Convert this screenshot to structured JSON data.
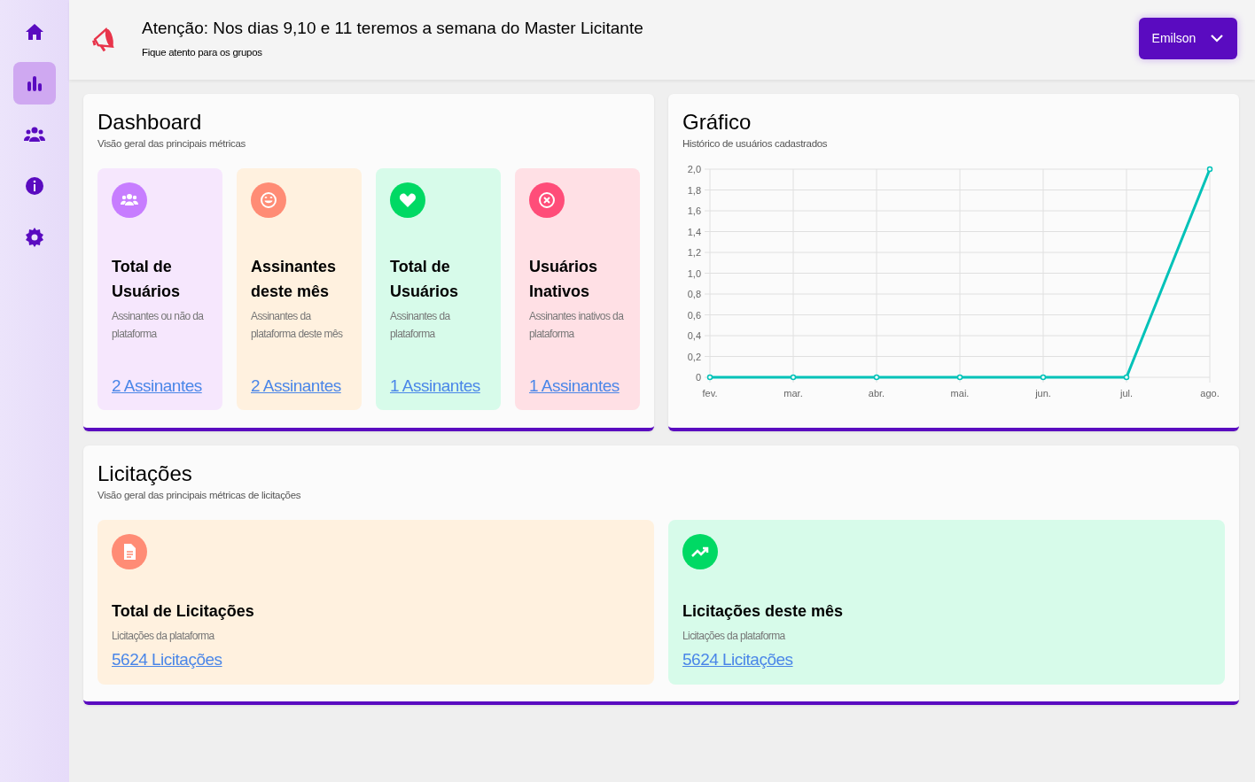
{
  "sidebar": {
    "items": [
      {
        "selected": false
      },
      {
        "selected": true
      },
      {
        "selected": false
      },
      {
        "selected": false
      },
      {
        "selected": false
      }
    ]
  },
  "announcement": {
    "title": "Atenção: Nos dias 9,10 e 11 teremos a semana do Master Licitante",
    "subtitle": "Fique atento para os grupos"
  },
  "user_menu": {
    "label": "Emilson"
  },
  "dashboard": {
    "title": "Dashboard",
    "subtitle": "Visão geral das principais métricas",
    "stats": [
      {
        "title": "Total de Usuários",
        "description": "Assinantes ou não da plataforma",
        "value": "2 Assinantes",
        "color": "#c77dff"
      },
      {
        "title": "Assinantes deste mês",
        "description": "Assinantes da plataforma deste mês",
        "value": "2 Assinantes",
        "color": "#ff8c75"
      },
      {
        "title": "Total de Usuários",
        "description": "Assinantes da plataforma",
        "value": "1 Assinantes",
        "color": "#00d964"
      },
      {
        "title": "Usuários Inativos",
        "description": "Assinantes inativos da plataforma",
        "value": "1 Assinantes",
        "color": "#ff4d79"
      }
    ]
  },
  "chart_panel": {
    "title": "Gráfico",
    "subtitle": "Histórico de usuários cadastrados",
    "chart_data": {
      "type": "line",
      "categories": [
        "fev.",
        "mar.",
        "abr.",
        "mai.",
        "jun.",
        "jul.",
        "ago."
      ],
      "grid": true,
      "series": [
        {
          "color": "#00c2b8",
          "marker": true,
          "values": [
            0,
            0,
            0,
            0,
            0,
            0,
            2
          ]
        }
      ],
      "ylim": [
        0,
        2
      ],
      "yticks": [
        {
          "value": 0,
          "label": "0"
        },
        {
          "value": 0.2,
          "label": "0,2"
        },
        {
          "value": 0.4,
          "label": "0,4"
        },
        {
          "value": 0.6,
          "label": "0,6"
        },
        {
          "value": 0.8,
          "label": "0,8"
        },
        {
          "value": 1,
          "label": "1,0"
        },
        {
          "value": 1.2,
          "label": "1,2"
        },
        {
          "value": 1.4,
          "label": "1,4"
        },
        {
          "value": 1.6,
          "label": "1,6"
        },
        {
          "value": 1.8,
          "label": "1,8"
        },
        {
          "value": 2,
          "label": "2,0"
        }
      ]
    }
  },
  "licitacoes": {
    "title": "Licitações",
    "subtitle": "Visão geral das principais métricas de licitações",
    "stats": [
      {
        "title": "Total de Licitações",
        "description": "Licitações da plataforma",
        "value": "5624 Licitações",
        "color": "#ff8c75"
      },
      {
        "title": "Licitações deste mês",
        "description": "Licitações da plataforma",
        "value": "5624 Licitações",
        "color": "#00d964"
      }
    ]
  }
}
